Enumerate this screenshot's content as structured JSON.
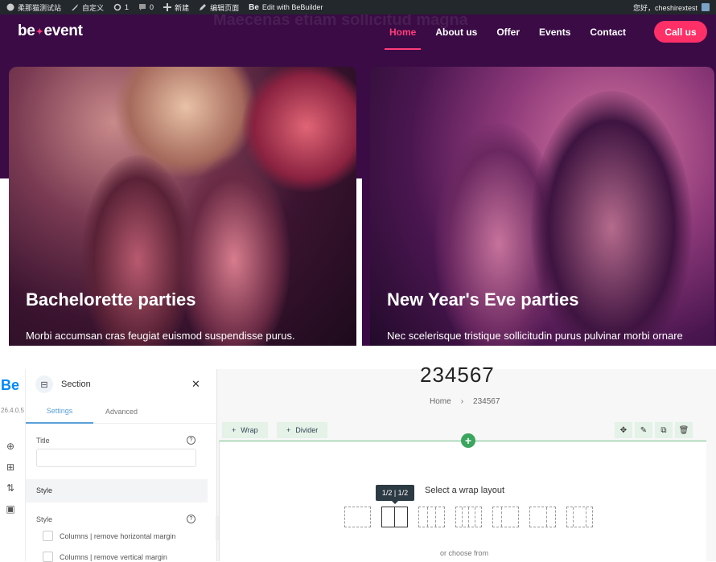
{
  "adminbar": {
    "site_name": "柔那猫测试站",
    "customize": "自定义",
    "updates": "1",
    "comments": "0",
    "new": "新建",
    "edit_page": "编辑页面",
    "be_edit": "Edit with BeBuilder",
    "greeting": "您好，cheshirextest"
  },
  "header": {
    "logo_left": "be",
    "logo_right": "event",
    "ghost": "Maecenas etiam sollicitud magna",
    "nav": [
      "Home",
      "About us",
      "Offer",
      "Events",
      "Contact"
    ],
    "active_nav": "Home",
    "cta": "Call us",
    "accent": "#ff2f68",
    "bg": "#3a0b45"
  },
  "cards": [
    {
      "title": "Bachelorette parties",
      "subtitle": "Morbi accumsan cras feugiat euismod suspendisse purus."
    },
    {
      "title": "New Year's Eve parties",
      "subtitle": "Nec scelerisque tristique sollicitudin purus pulvinar morbi ornare"
    }
  ],
  "builder": {
    "logo": "Be",
    "version": "26.4.0.5",
    "panel": {
      "title": "Section",
      "tabs": [
        "Settings",
        "Advanced"
      ],
      "title_label": "Title",
      "style_section": "Style",
      "style_label": "Style",
      "checkboxes": [
        "Columns | remove horizontal margin",
        "Columns | remove vertical margin"
      ]
    },
    "canvas": {
      "page_title": "234567",
      "breadcrumb": [
        "Home",
        "234567"
      ],
      "wrap_button": "Wrap",
      "divider_button": "Divider",
      "tooltip": "1/2 | 1/2",
      "wrap_title": "Select a wrap layout",
      "choose": "or choose from"
    }
  }
}
